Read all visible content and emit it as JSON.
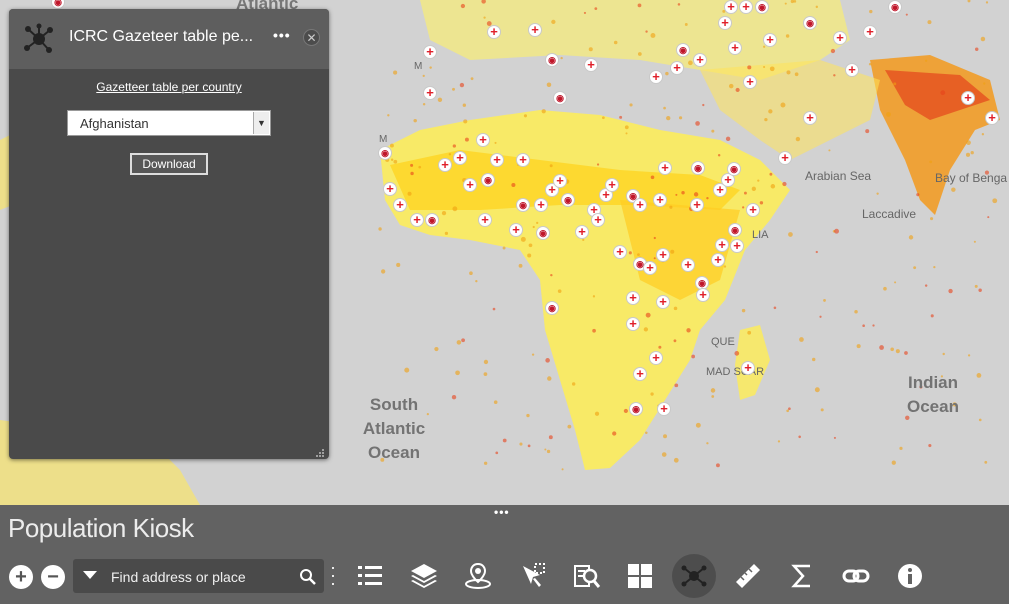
{
  "map": {
    "labels": {
      "atlantic_top": "Atlantic",
      "arabian_sea": "Arabian Sea",
      "bay_of_bengal": "Bay of Benga",
      "laccadive": "Laccadive",
      "madagascar": "MAD    SCAR",
      "mozambique": "QUE",
      "somalia": "LIA",
      "m_left": "M",
      "m_left2": "M"
    },
    "oceans": {
      "south_atlantic": [
        "South",
        "Atlantic",
        "Ocean"
      ],
      "indian": [
        "Indian",
        "Ocean"
      ]
    },
    "colors": {
      "land": "#d2d2d2",
      "density_low": "#fff44f",
      "density_mid": "#ffbf00",
      "density_high": "#e8431a",
      "marker_red": "#e0202a"
    }
  },
  "panel": {
    "icon": "network-hub-icon",
    "title": "ICRC Gazeteer table pe...",
    "more_icon": "more-dots-icon",
    "close_icon": "close-circle-icon",
    "link": "Gazetteer table per country",
    "country_select": {
      "value": "Afghanistan"
    },
    "download_label": "Download"
  },
  "bottombar": {
    "grip": "•••",
    "app_title": "Population Kiosk",
    "zoom_in": "+",
    "zoom_out": "−",
    "search": {
      "placeholder": "Find address or place"
    },
    "tools": [
      "legend-list-icon",
      "layers-icon",
      "location-pin-icon",
      "select-cursor-icon",
      "query-search-icon",
      "grid-widget-icon",
      "network-hub-icon",
      "ruler-icon",
      "sum-icon",
      "link-icon",
      "info-icon"
    ]
  }
}
